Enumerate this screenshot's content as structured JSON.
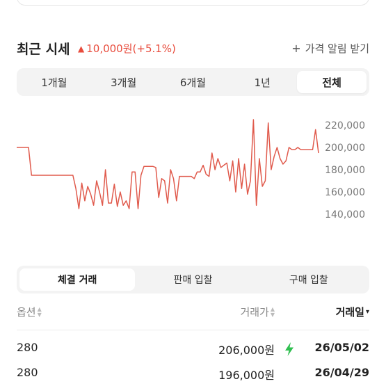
{
  "price_header": {
    "title": "최근 시세",
    "change_icon": "up-triangle-icon",
    "change": "10,000원(+5.1%)",
    "change_color": "#e84b3c",
    "alert_label": "가격 알림 받기"
  },
  "period_tabs": [
    {
      "label": "1개월"
    },
    {
      "label": "3개월"
    },
    {
      "label": "6개월"
    },
    {
      "label": "1년"
    },
    {
      "label": "전체"
    }
  ],
  "period_selected": "전체",
  "chart_data": {
    "type": "line",
    "series_color": "#e05a4c",
    "y_ticks": [
      "220,000",
      "200,000",
      "180,000",
      "160,000",
      "140,000"
    ],
    "ylim": [
      140000,
      220000
    ],
    "values": [
      200000,
      200000,
      200000,
      200000,
      200000,
      175000,
      175000,
      175000,
      175000,
      175000,
      175000,
      175000,
      175000,
      175000,
      175000,
      175000,
      175000,
      175000,
      175000,
      175000,
      163000,
      145000,
      168000,
      152000,
      165000,
      158000,
      148000,
      170000,
      160000,
      148000,
      180000,
      150000,
      150000,
      167000,
      147000,
      160000,
      148000,
      152000,
      145000,
      178000,
      178000,
      145000,
      175000,
      183000,
      183000,
      183000,
      183000,
      182000,
      155000,
      172000,
      170000,
      150000,
      180000,
      172000,
      152000,
      174000,
      174000,
      174000,
      174000,
      174000,
      172000,
      178000,
      178000,
      184000,
      176000,
      174000,
      195000,
      180000,
      190000,
      182000,
      184000,
      186000,
      170000,
      188000,
      160000,
      190000,
      163000,
      185000,
      158000,
      170000,
      225000,
      148000,
      190000,
      165000,
      170000,
      222000,
      180000,
      192000,
      200000,
      190000,
      185000,
      188000,
      200000,
      198000,
      198000,
      200000,
      198000,
      198000,
      198000,
      198000,
      198000,
      216000,
      195000
    ]
  },
  "trade_tabs": [
    {
      "label": "체결 거래"
    },
    {
      "label": "판매 입찰"
    },
    {
      "label": "구매 입찰"
    }
  ],
  "trade_selected": "체결 거래",
  "table": {
    "columns": {
      "option": "옵션",
      "price": "거래가",
      "date": "거래일"
    },
    "sorted_by": "거래일",
    "rows": [
      {
        "option": "280",
        "price": "206,000원",
        "quick_icon": "lightning-bolt-icon",
        "date": "26/05/02"
      },
      {
        "option": "280",
        "price": "196,000원",
        "quick_icon": "",
        "date": "26/04/29"
      }
    ]
  }
}
